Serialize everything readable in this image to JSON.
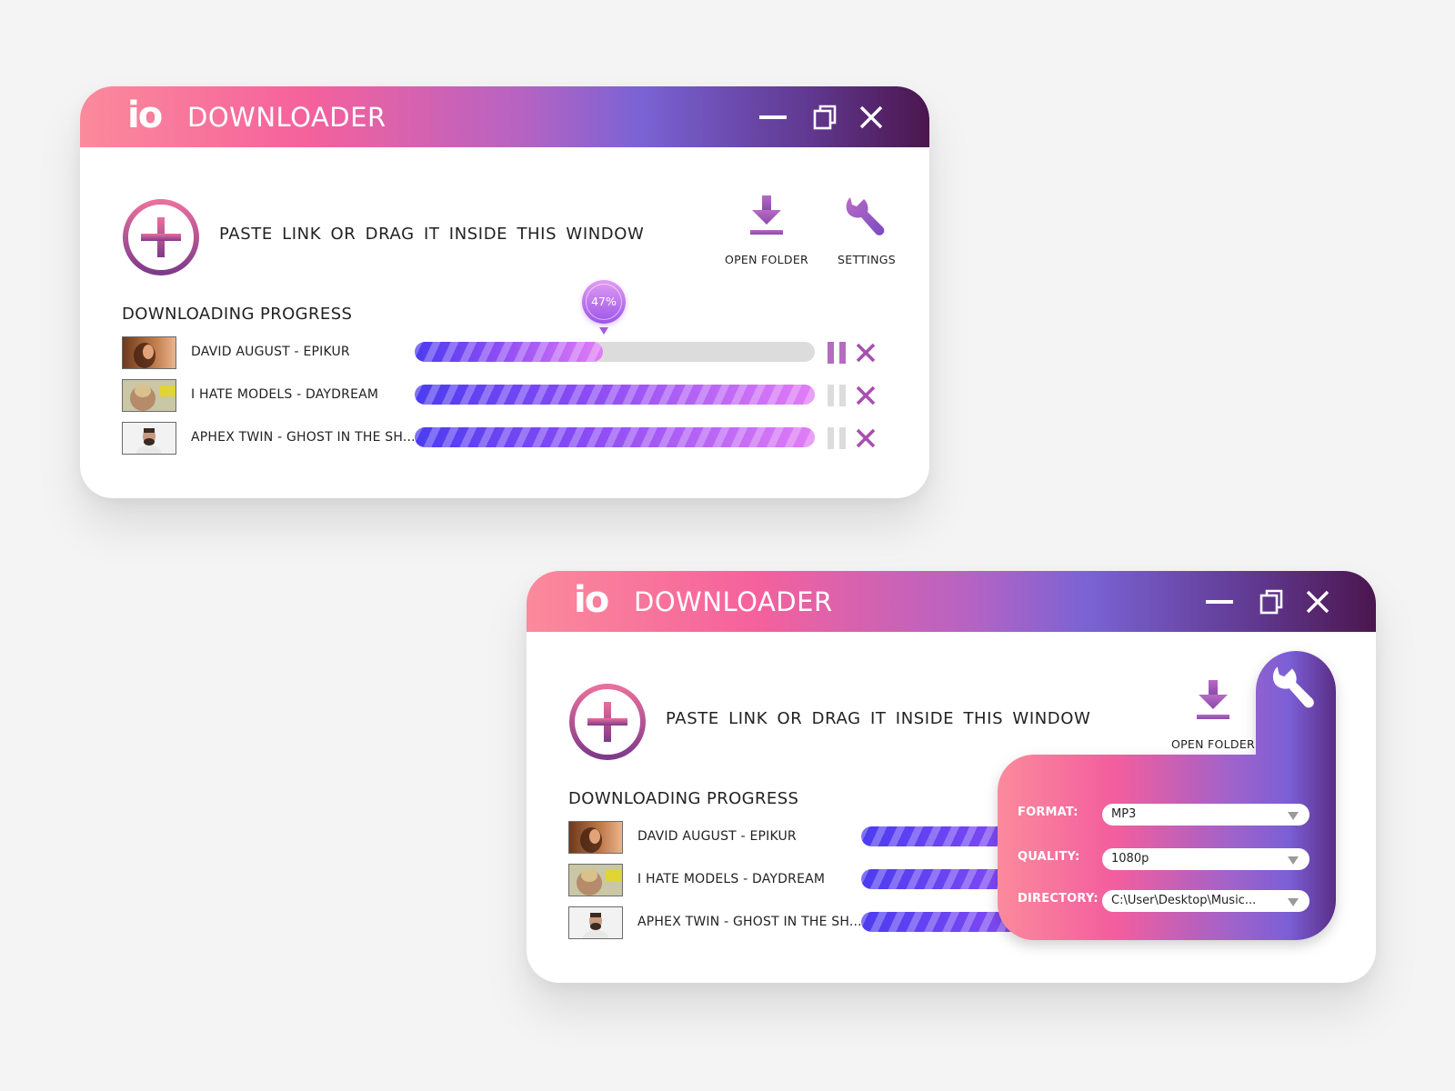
{
  "app": {
    "logo_text": "io",
    "title": "DOWNLOADER"
  },
  "colors": {
    "accent_purple": "#a94fb0",
    "pause_active": "#b36cbf",
    "pause_inactive": "#dcdcdc",
    "cancel": "#a94fb0",
    "progress_start": "#4c3cf0",
    "progress_end": "#e27df6"
  },
  "icons": {
    "minimize": "minimize-icon",
    "maximize": "restore-icon",
    "close": "close-icon",
    "add": "plus-circle-icon",
    "open_folder": "download-arrow-icon",
    "settings": "wrench-icon",
    "pause": "pause-icon",
    "cancel": "x-icon"
  },
  "toolbar": {
    "paste_prompt": "PASTE LINK OR DRAG IT INSIDE THIS WINDOW",
    "open_folder_label": "OPEN FOLDER",
    "settings_label": "SETTINGS"
  },
  "downloads": {
    "section_title": "DOWNLOADING PROGRESS",
    "items": [
      {
        "name": "DAVID AUGUST - EPIKUR",
        "progress": 0.47,
        "badge": "47%",
        "paused": false
      },
      {
        "name": "I HATE MODELS - DAYDREAM",
        "progress": 1.0,
        "paused": true
      },
      {
        "name": "APHEX TWIN - GHOST IN THE SH...",
        "progress": 1.0,
        "paused": true
      }
    ]
  },
  "settings_panel": {
    "format_label": "FORMAT:",
    "format_value": "MP3",
    "quality_label": "QUALITY:",
    "quality_value": "1080p",
    "directory_label": "DIRECTORY:",
    "directory_value": "C:\\User\\Desktop\\Music..."
  }
}
